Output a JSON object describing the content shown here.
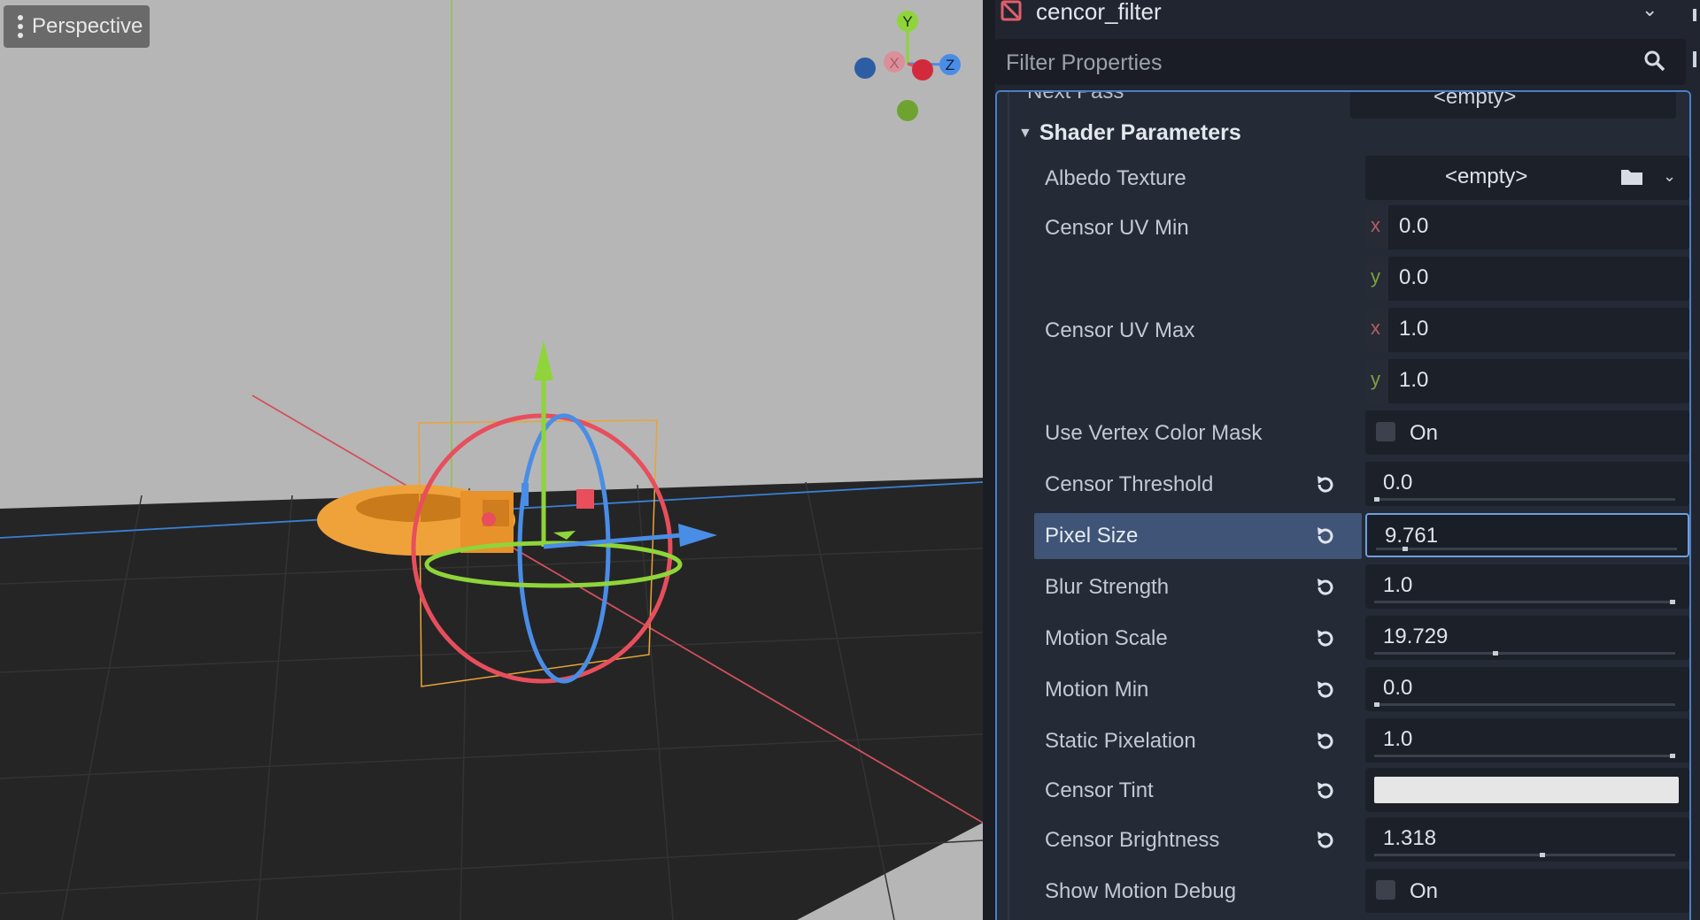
{
  "viewport": {
    "mode_label": "Perspective",
    "gizmo": {
      "y": "Y",
      "x": "X",
      "z": "Z"
    },
    "colors": {
      "floor": "#252525",
      "background": "#b6b6b6",
      "object": "#f0a23a"
    }
  },
  "inspector": {
    "resource_name": "cencor_filter",
    "filter_placeholder": "Filter Properties",
    "next_pass": {
      "label": "Next Pass",
      "value": "<empty>"
    },
    "section_title": "Shader Parameters",
    "albedo": {
      "label": "Albedo Texture",
      "value": "<empty>"
    },
    "uv_min": {
      "label": "Censor UV Min",
      "x_axis": "x",
      "y_axis": "y",
      "x": "0.0",
      "y": "0.0"
    },
    "uv_max": {
      "label": "Censor UV Max",
      "x_axis": "x",
      "y_axis": "y",
      "x": "1.0",
      "y": "1.0"
    },
    "vertex_mask": {
      "label": "Use Vertex Color Mask",
      "value": "On",
      "checked": false
    },
    "threshold": {
      "label": "Censor Threshold",
      "value": "0.0",
      "fraction": 0.0
    },
    "pixel_size": {
      "label": "Pixel Size",
      "value": "9.761",
      "fraction": 0.09
    },
    "blur": {
      "label": "Blur Strength",
      "value": "1.0",
      "fraction": 1.0
    },
    "motion_scale": {
      "label": "Motion Scale",
      "value": "19.729",
      "fraction": 0.4
    },
    "motion_min": {
      "label": "Motion Min",
      "value": "0.0",
      "fraction": 0.0
    },
    "static_pix": {
      "label": "Static Pixelation",
      "value": "1.0",
      "fraction": 1.0
    },
    "tint": {
      "label": "Censor Tint",
      "color": "#e6e6e6"
    },
    "brightness": {
      "label": "Censor Brightness",
      "value": "1.318",
      "fraction": 0.56
    },
    "motion_debug": {
      "label": "Show Motion Debug",
      "value": "On",
      "checked": false
    }
  }
}
